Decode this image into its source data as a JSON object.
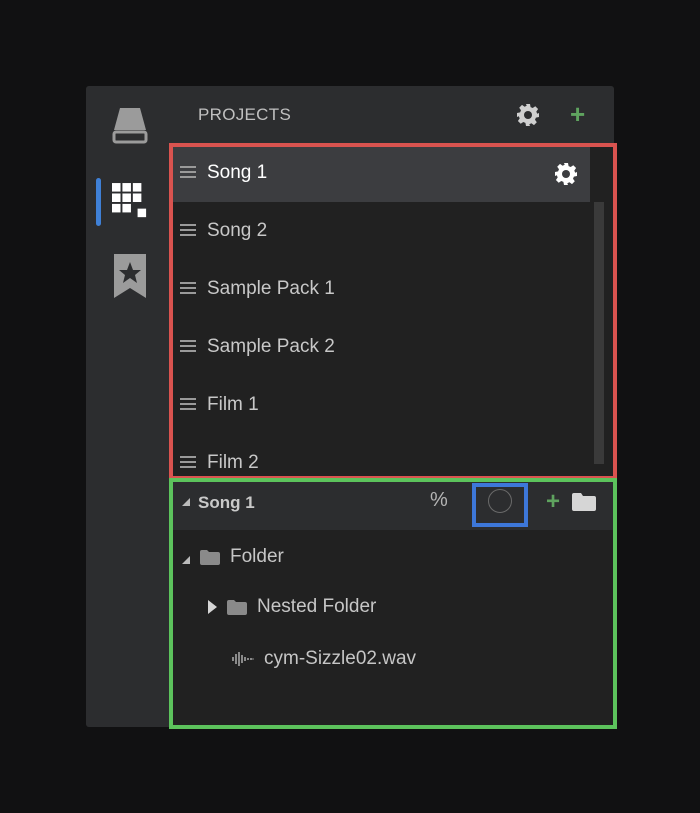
{
  "sidebar": {
    "icons": [
      {
        "name": "drive-icon"
      },
      {
        "name": "grid-icon",
        "active": true
      },
      {
        "name": "bookmark-star-icon"
      }
    ],
    "active_color": "#3f80d6"
  },
  "projects": {
    "title": "PROJECTS",
    "items": [
      {
        "label": "Song 1",
        "selected": true
      },
      {
        "label": "Song 2"
      },
      {
        "label": "Sample Pack 1"
      },
      {
        "label": "Sample Pack 2"
      },
      {
        "label": "Film 1"
      },
      {
        "label": "Film 2"
      }
    ]
  },
  "tree": {
    "title": "Song 1",
    "percent_label": "%",
    "items": [
      {
        "label": "Folder",
        "type": "folder",
        "expanded": true
      },
      {
        "label": "Nested Folder",
        "type": "folder",
        "expanded": false
      },
      {
        "label": "cym-Sizzle02.wav",
        "type": "audio-file"
      }
    ]
  },
  "colors": {
    "add_green": "#5fa35f",
    "highlight_red": "#d9534f",
    "highlight_green": "#5cc35c",
    "highlight_blue": "#3d77d9"
  }
}
